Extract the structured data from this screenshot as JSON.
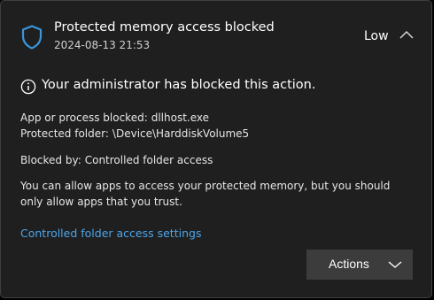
{
  "header": {
    "title": "Protected memory access blocked",
    "timestamp": "2024-08-13 21:53",
    "severity": "Low",
    "icon": "shield-icon",
    "accent_color": "#3a96dd"
  },
  "body": {
    "headline": "Your administrator has blocked this action.",
    "details": [
      {
        "label": "App or process blocked:",
        "value": "dllhost.exe"
      },
      {
        "label": "Protected folder:",
        "value": "\\Device\\HarddiskVolume5"
      },
      {
        "label": "Blocked by:",
        "value": "Controlled folder access"
      }
    ],
    "message": "You can allow apps to access your protected memory, but you should only allow apps that you trust."
  },
  "footer": {
    "settings_link": "Controlled folder access settings",
    "link_color": "#4ca6ec",
    "actions_label": "Actions"
  }
}
